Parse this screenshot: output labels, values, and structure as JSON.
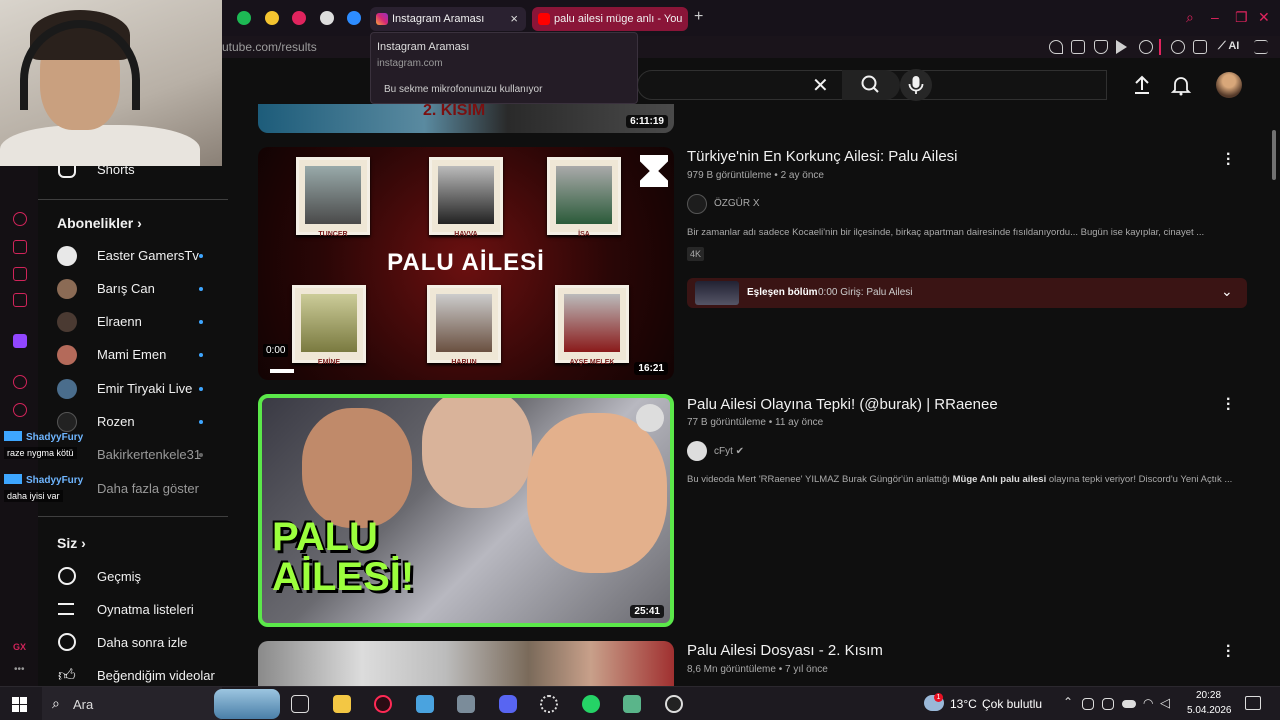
{
  "browser": {
    "tabs": [
      {
        "title": "Instagram Araması",
        "active": true
      },
      {
        "title": "palu ailesi müge anlı - You",
        "active": false
      }
    ],
    "new_tab": "+",
    "url": "utube.com/results",
    "ai_label": "AI",
    "tooltip": {
      "title": "Instagram Araması",
      "domain": "instagram.com",
      "note": "Bu sekme mikrofonunuzu kullanıyor"
    }
  },
  "youtube": {
    "clear_icon": "✕",
    "sidebar": {
      "shorts": "Shorts",
      "subscriptions_title": "Abonelikler",
      "subscriptions": [
        {
          "name": "Easter GamersTv"
        },
        {
          "name": "Barış Can"
        },
        {
          "name": "Elraenn"
        },
        {
          "name": "Mami Emen"
        },
        {
          "name": "Emir Tiryaki Live"
        },
        {
          "name": "Rozen"
        },
        {
          "name": "Bakirkertenkele31"
        }
      ],
      "show_more": "Daha fazla göster",
      "you_title": "Siz",
      "you_items": [
        {
          "label": "Geçmiş"
        },
        {
          "label": "Oynatma listeleri"
        },
        {
          "label": "Daha sonra izle"
        },
        {
          "label": "Beğendiğim videolar"
        }
      ]
    },
    "results": [
      {
        "title": "Türkiye'nin En Korkunç Ailesi: Palu Ailesi",
        "views": "979 B görüntüleme",
        "age": "2 ay önce",
        "channel": "ÖZGÜR X",
        "description": "Bir zamanlar adı sadece Kocaeli'nin bir ilçesinde, birkaç apartman dairesinde fısıldanıyordu... Bugün ise kayıplar, cinayet ...",
        "badge": "4K",
        "duration": "16:21",
        "progress_time": "0:00",
        "thumb_title": "PALU AİLESİ",
        "thumb_names": [
          "TUNCER",
          "HAVVA",
          "İSA",
          "EMİNE",
          "HARUN",
          "AYŞE MELEK"
        ],
        "chapter": {
          "label": "Eşleşen bölüm",
          "text": "0:00 Giriş: Palu Ailesi"
        }
      },
      {
        "title": "Palu Ailesi Olayına Tepki! (@burak) | RRaenee",
        "views": "77 B görüntüleme",
        "age": "11 ay önce",
        "channel": "cFyt",
        "description_pre": "Bu videoda Mert 'RRaenee' YILMAZ Burak Güngör'ün anlattığı ",
        "description_bold": "Müge Anlı palu ailesi",
        "description_post": " olayına tepki veriyor! Discord'u Yeni Açtık ...",
        "duration": "25:41",
        "thumb_text_1": "PALU",
        "thumb_text_2": "AİLESİ!"
      },
      {
        "title": "Palu Ailesi Dosyası - 2. Kısım",
        "views": "8,6 Mn görüntüleme",
        "age": "7 yıl önce"
      }
    ],
    "top_thumb_duration": "6:11:19",
    "top_thumb_text": "2. KISIM"
  },
  "chat_overlay": [
    {
      "user": "ShadyyFury",
      "message": "raze nygma kötü"
    },
    {
      "user": "ShadyyFury",
      "message": "daha iyisi var"
    }
  ],
  "taskbar": {
    "search": "Ara",
    "weather_badge": "1",
    "weather_temp": "13°C",
    "weather_text": "Çok bulutlu",
    "time": "20:28",
    "date": "5.04.2026"
  },
  "colors": {
    "accent": "#e0245e",
    "chapter_bg": "#3a1414",
    "green_frame": "#5be84a"
  }
}
